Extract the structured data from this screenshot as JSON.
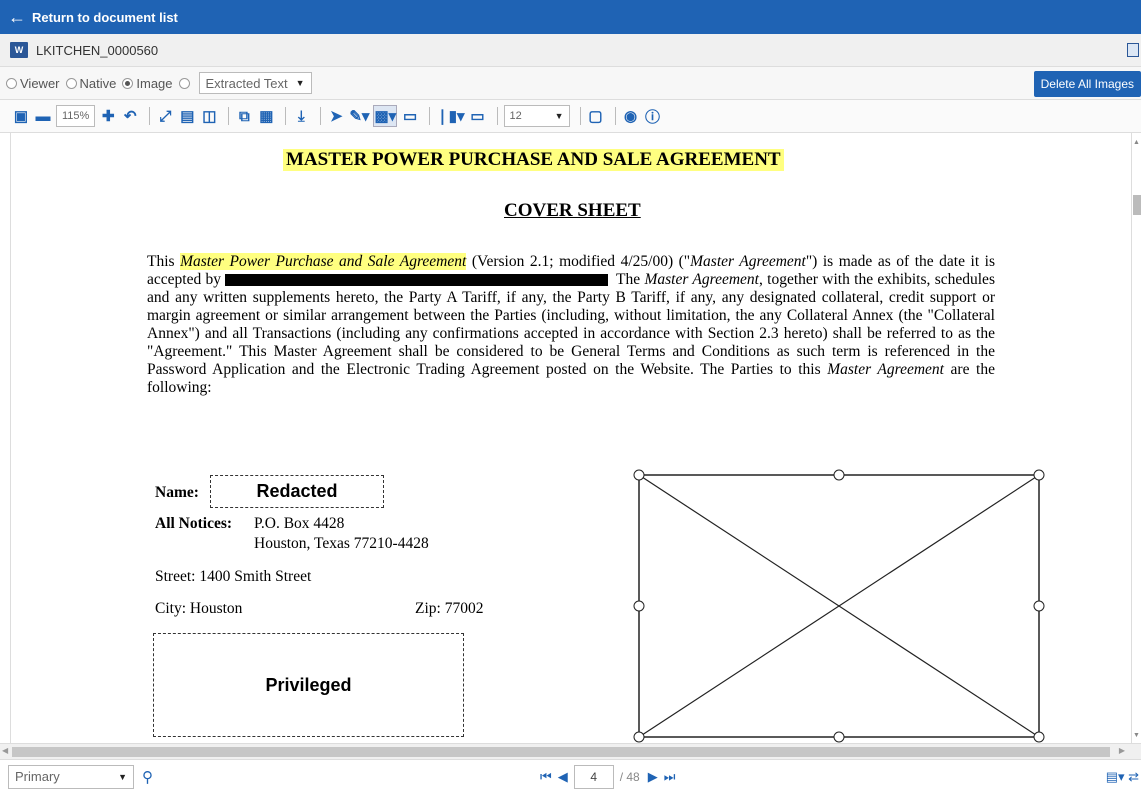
{
  "topbar": {
    "back_label": "Return to document list"
  },
  "document": {
    "file_icon": "word-icon",
    "name": "LKITCHEN_0000560"
  },
  "modes": {
    "options": [
      "Viewer",
      "Native",
      "Image"
    ],
    "selected": "Image",
    "extracted_text_label": "Extracted Text",
    "delete_all_images": "Delete All Images"
  },
  "toolbar": {
    "zoom": "115%",
    "stamp_size": "12",
    "icons": [
      "image-icon",
      "zoom-out-icon",
      "zoom-in-icon",
      "rotate-icon",
      "fit-page-icon",
      "fit-width-icon",
      "split-view-icon",
      "copy-image-icon",
      "image-edit-icon",
      "download-icon",
      "select-icon",
      "highlight-icon",
      "redact-icon",
      "stamp-icon",
      "mass-redact-icon",
      "page-icon",
      "delete-icon",
      "eye-icon",
      "info-icon"
    ]
  },
  "page": {
    "title": "MASTER POWER PURCHASE AND SALE AGREEMENT",
    "subtitle": "COVER SHEET",
    "para": {
      "t1": "This ",
      "hl": "Master Power Purchase and Sale Agreement",
      "t2": " (Version 2.1; modified 4/25/00) (\"",
      "it1": "Master Agreement",
      "t3": "\") is made as of the date it is accepted by",
      "t4": "The ",
      "it2": "Master Agreement",
      "t5": ", together with the exhibits, schedules and any written supplements hereto, the Party A Tariff, if any, the Party B Tariff, if any, any designated collateral, credit support or margin agreement or similar arrangement between the Parties (including, without limitation, the any Collateral Annex (the \"Collateral Annex\") and all Transactions (including any confirmations accepted in accordance with Section 2.3 hereto) shall be referred to as the \"Agreement.\" This Master Agreement shall be considered to be General Terms and Conditions as such term is referenced in the Password Application and the Electronic Trading Agreement posted on the Website. The Parties to this ",
      "it3": "Master Agreement",
      "t6": " are the following:"
    },
    "name_label": "Name:",
    "redacted": "Redacted",
    "notices_label": "All Notices:",
    "notices_line1": "P.O. Box 4428",
    "notices_line2": "Houston, Texas 77210-4428",
    "street": "Street: 1400 Smith Street",
    "city": "City: Houston",
    "zip": "Zip: 77002",
    "privileged": "Privileged"
  },
  "footer": {
    "layer": "Primary",
    "page_current": "4",
    "page_total": "/ 48"
  },
  "colors": {
    "accent": "#1f63b4",
    "highlight": "#ffff80"
  }
}
